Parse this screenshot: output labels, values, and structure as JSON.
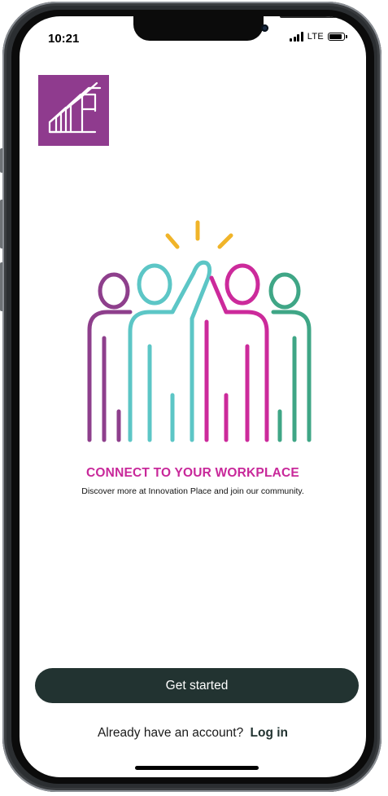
{
  "status_bar": {
    "time": "10:21",
    "network": "LTE",
    "battery_level": 0.9
  },
  "logo": {
    "icon": "building-steps-logo-icon",
    "color": "#8f3b8e"
  },
  "illustration": {
    "icon": "group-high-five-icon",
    "colors": {
      "purple": "#8e3f8c",
      "teal": "#5cc6c6",
      "magenta": "#cc2a9b",
      "green": "#3fa686",
      "yellow": "#f0b429"
    }
  },
  "onboarding": {
    "headline": "CONNECT TO YOUR WORKPLACE",
    "subline": "Discover more at Innovation Place and join our community."
  },
  "actions": {
    "get_started_label": "Get started",
    "account_prompt": "Already have an account?",
    "login_label": "Log in",
    "button_color": "#223331"
  }
}
